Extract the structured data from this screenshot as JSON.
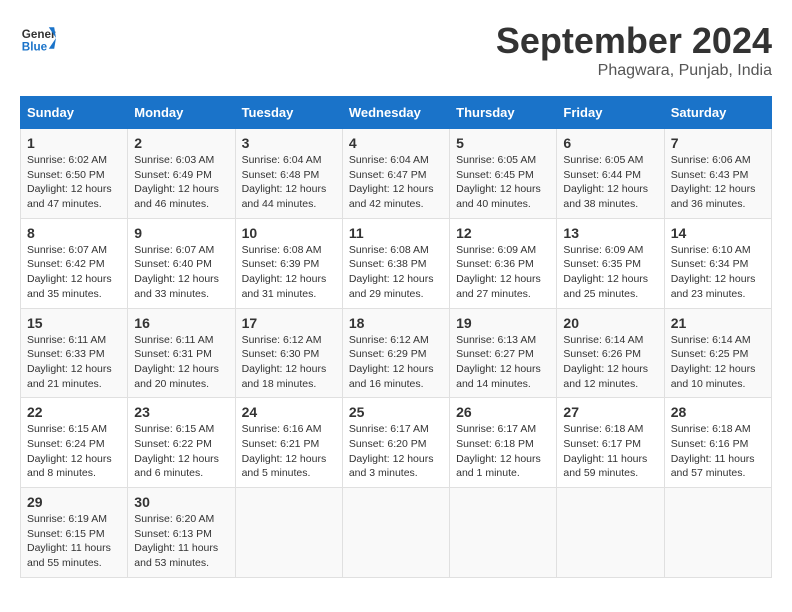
{
  "header": {
    "logo_line1": "General",
    "logo_line2": "Blue",
    "month": "September 2024",
    "location": "Phagwara, Punjab, India"
  },
  "days_of_week": [
    "Sunday",
    "Monday",
    "Tuesday",
    "Wednesday",
    "Thursday",
    "Friday",
    "Saturday"
  ],
  "weeks": [
    [
      {
        "day": "1",
        "info": "Sunrise: 6:02 AM\nSunset: 6:50 PM\nDaylight: 12 hours\nand 47 minutes."
      },
      {
        "day": "2",
        "info": "Sunrise: 6:03 AM\nSunset: 6:49 PM\nDaylight: 12 hours\nand 46 minutes."
      },
      {
        "day": "3",
        "info": "Sunrise: 6:04 AM\nSunset: 6:48 PM\nDaylight: 12 hours\nand 44 minutes."
      },
      {
        "day": "4",
        "info": "Sunrise: 6:04 AM\nSunset: 6:47 PM\nDaylight: 12 hours\nand 42 minutes."
      },
      {
        "day": "5",
        "info": "Sunrise: 6:05 AM\nSunset: 6:45 PM\nDaylight: 12 hours\nand 40 minutes."
      },
      {
        "day": "6",
        "info": "Sunrise: 6:05 AM\nSunset: 6:44 PM\nDaylight: 12 hours\nand 38 minutes."
      },
      {
        "day": "7",
        "info": "Sunrise: 6:06 AM\nSunset: 6:43 PM\nDaylight: 12 hours\nand 36 minutes."
      }
    ],
    [
      {
        "day": "8",
        "info": "Sunrise: 6:07 AM\nSunset: 6:42 PM\nDaylight: 12 hours\nand 35 minutes."
      },
      {
        "day": "9",
        "info": "Sunrise: 6:07 AM\nSunset: 6:40 PM\nDaylight: 12 hours\nand 33 minutes."
      },
      {
        "day": "10",
        "info": "Sunrise: 6:08 AM\nSunset: 6:39 PM\nDaylight: 12 hours\nand 31 minutes."
      },
      {
        "day": "11",
        "info": "Sunrise: 6:08 AM\nSunset: 6:38 PM\nDaylight: 12 hours\nand 29 minutes."
      },
      {
        "day": "12",
        "info": "Sunrise: 6:09 AM\nSunset: 6:36 PM\nDaylight: 12 hours\nand 27 minutes."
      },
      {
        "day": "13",
        "info": "Sunrise: 6:09 AM\nSunset: 6:35 PM\nDaylight: 12 hours\nand 25 minutes."
      },
      {
        "day": "14",
        "info": "Sunrise: 6:10 AM\nSunset: 6:34 PM\nDaylight: 12 hours\nand 23 minutes."
      }
    ],
    [
      {
        "day": "15",
        "info": "Sunrise: 6:11 AM\nSunset: 6:33 PM\nDaylight: 12 hours\nand 21 minutes."
      },
      {
        "day": "16",
        "info": "Sunrise: 6:11 AM\nSunset: 6:31 PM\nDaylight: 12 hours\nand 20 minutes."
      },
      {
        "day": "17",
        "info": "Sunrise: 6:12 AM\nSunset: 6:30 PM\nDaylight: 12 hours\nand 18 minutes."
      },
      {
        "day": "18",
        "info": "Sunrise: 6:12 AM\nSunset: 6:29 PM\nDaylight: 12 hours\nand 16 minutes."
      },
      {
        "day": "19",
        "info": "Sunrise: 6:13 AM\nSunset: 6:27 PM\nDaylight: 12 hours\nand 14 minutes."
      },
      {
        "day": "20",
        "info": "Sunrise: 6:14 AM\nSunset: 6:26 PM\nDaylight: 12 hours\nand 12 minutes."
      },
      {
        "day": "21",
        "info": "Sunrise: 6:14 AM\nSunset: 6:25 PM\nDaylight: 12 hours\nand 10 minutes."
      }
    ],
    [
      {
        "day": "22",
        "info": "Sunrise: 6:15 AM\nSunset: 6:24 PM\nDaylight: 12 hours\nand 8 minutes."
      },
      {
        "day": "23",
        "info": "Sunrise: 6:15 AM\nSunset: 6:22 PM\nDaylight: 12 hours\nand 6 minutes."
      },
      {
        "day": "24",
        "info": "Sunrise: 6:16 AM\nSunset: 6:21 PM\nDaylight: 12 hours\nand 5 minutes."
      },
      {
        "day": "25",
        "info": "Sunrise: 6:17 AM\nSunset: 6:20 PM\nDaylight: 12 hours\nand 3 minutes."
      },
      {
        "day": "26",
        "info": "Sunrise: 6:17 AM\nSunset: 6:18 PM\nDaylight: 12 hours\nand 1 minute."
      },
      {
        "day": "27",
        "info": "Sunrise: 6:18 AM\nSunset: 6:17 PM\nDaylight: 11 hours\nand 59 minutes."
      },
      {
        "day": "28",
        "info": "Sunrise: 6:18 AM\nSunset: 6:16 PM\nDaylight: 11 hours\nand 57 minutes."
      }
    ],
    [
      {
        "day": "29",
        "info": "Sunrise: 6:19 AM\nSunset: 6:15 PM\nDaylight: 11 hours\nand 55 minutes."
      },
      {
        "day": "30",
        "info": "Sunrise: 6:20 AM\nSunset: 6:13 PM\nDaylight: 11 hours\nand 53 minutes."
      },
      {
        "day": "",
        "info": ""
      },
      {
        "day": "",
        "info": ""
      },
      {
        "day": "",
        "info": ""
      },
      {
        "day": "",
        "info": ""
      },
      {
        "day": "",
        "info": ""
      }
    ]
  ]
}
